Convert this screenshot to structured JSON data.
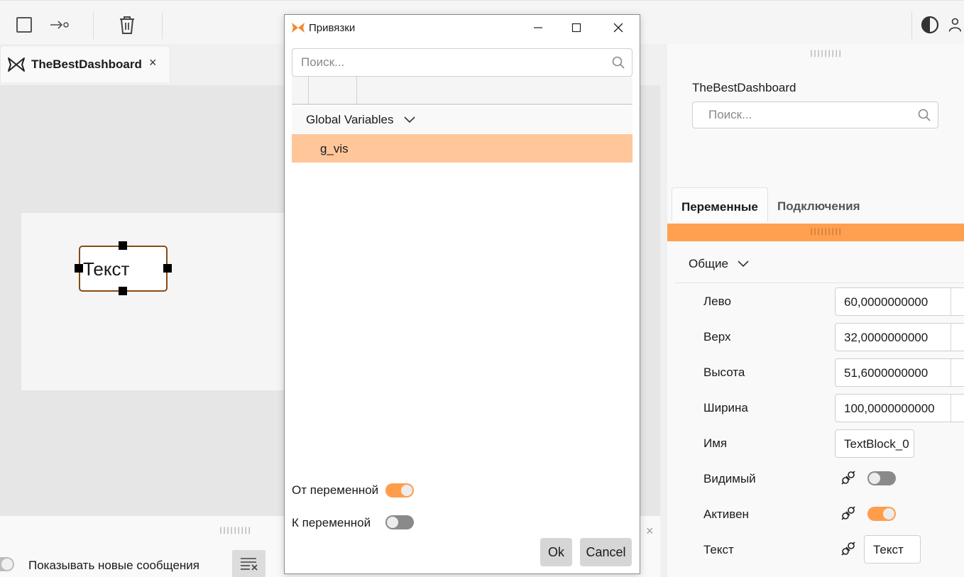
{
  "document": {
    "tab_title": "TheBestDashboard",
    "tab_close": "×"
  },
  "canvas": {
    "text_element": "Текст"
  },
  "bottom": {
    "show_messages_label": "Показывать новые сообщения",
    "close": "×",
    "grip": "|||||||||"
  },
  "right_panel": {
    "title": "TheBestDashboard",
    "search_placeholder": "Поиск...",
    "grip": "|||||||||",
    "tabs": [
      {
        "label": "Переменные"
      },
      {
        "label": "Подключения"
      }
    ],
    "group": "Общие",
    "properties": {
      "left": {
        "label": "Лево",
        "value": "60,0000000000"
      },
      "top": {
        "label": "Верх",
        "value": "32,0000000000"
      },
      "height": {
        "label": "Высота",
        "value": "51,6000000000"
      },
      "width": {
        "label": "Ширина",
        "value": "100,0000000000"
      },
      "name": {
        "label": "Имя",
        "value": "TextBlock_0"
      },
      "visible": {
        "label": "Видимый",
        "enabled": false
      },
      "active": {
        "label": "Активен",
        "enabled": true
      },
      "text": {
        "label": "Текст",
        "value": "Текст"
      }
    }
  },
  "dialog": {
    "title": "Привязки",
    "search_placeholder": "Поиск...",
    "tree_group": "Global Variables",
    "selected_item": "g_vis",
    "from_variable": {
      "label": "От переменной",
      "enabled": true
    },
    "to_variable": {
      "label": "К переменной",
      "enabled": false
    },
    "ok_label": "Ok",
    "cancel_label": "Cancel"
  },
  "colors": {
    "accent": "#ffa050",
    "selection": "#ffc69a",
    "element_border": "#8a4a12"
  }
}
